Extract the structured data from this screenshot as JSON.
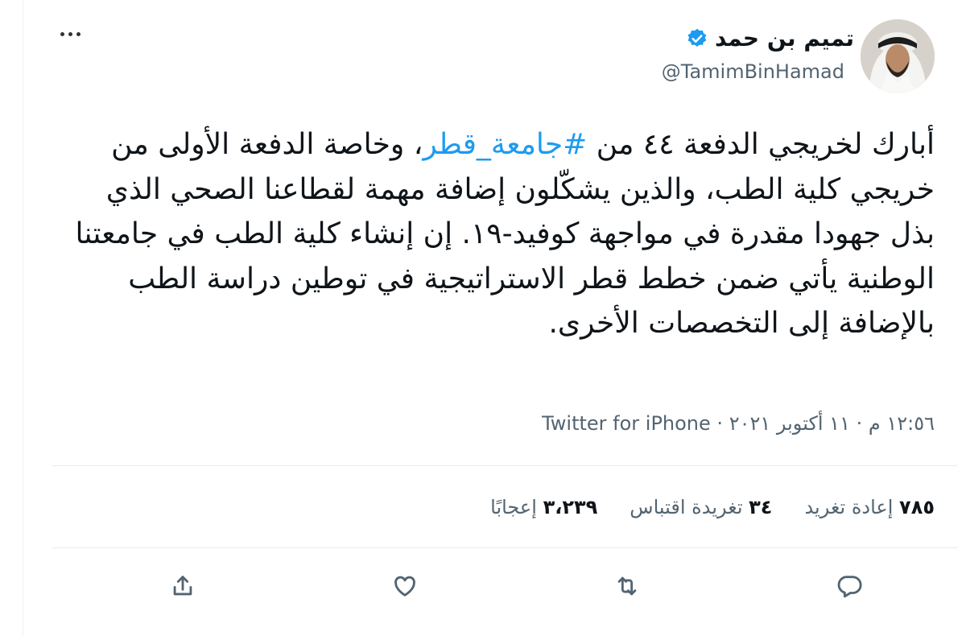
{
  "user": {
    "display_name": "تميم بن حمد",
    "handle": "@TamimBinHamad",
    "avatar_icon": "profile-photo",
    "verified_icon": "verified-badge-icon"
  },
  "tweet": {
    "text_before": "أبارك لخريجي الدفعة ٤٤ من ",
    "hashtag": "#جامعة_قطر",
    "text_after": "، وخاصة الدفعة الأولى من خريجي كلية الطب، والذين يشكّلون إضافة مهمة لقطاعنا الصحي الذي بذل جهودا مقدرة في مواجهة كوفيد-١٩. إن إنشاء كلية الطب في جامعتنا الوطنية يأتي ضمن خطط قطر الاستراتيجية في توطين دراسة الطب بالإضافة إلى التخصصات الأخرى."
  },
  "meta": {
    "time": "١٢:٥٦ م",
    "separator1": " · ",
    "date": "١١ أكتوبر ٢٠٢١",
    "separator2": " · ",
    "source": "Twitter for iPhone"
  },
  "stats": {
    "retweets_count": "٧٨٥",
    "retweets_label": "إعادة تغريد",
    "quotes_count": "٣٤",
    "quotes_label": "تغريدة اقتباس",
    "likes_count": "٣،٢٣٩",
    "likes_label": "إعجابًا"
  },
  "actions": [
    "reply-icon",
    "retweet-icon",
    "like-icon",
    "share-icon"
  ],
  "colors": {
    "accent": "#1d9bf0",
    "secondary_text": "#536471",
    "primary_text": "#0f1419"
  }
}
